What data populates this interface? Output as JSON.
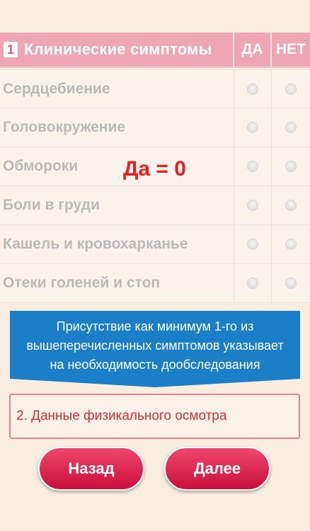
{
  "header": {
    "section_number": "1",
    "title": "Клинические симптомы",
    "col_yes": "ДА",
    "col_no": "НЕТ"
  },
  "symptoms": [
    {
      "label": "Сердцебиение"
    },
    {
      "label": "Головокружение"
    },
    {
      "label": "Обмороки"
    },
    {
      "label": "Боли в груди"
    },
    {
      "label": "Кашель и кровохарканье"
    },
    {
      "label": "Отеки голеней и стоп"
    }
  ],
  "result": "Да = 0",
  "info": {
    "line1": "Присутствие как минимум 1-го из",
    "line2": "вышеперечисленных симптомов указывает",
    "line3": "на необходимость дообследования"
  },
  "next_section": "2. Данные физикального осмотра",
  "buttons": {
    "back": "Назад",
    "next": "Далее"
  },
  "colors": {
    "header": "#eea6b5",
    "accent_red": "#e8201e",
    "info_blue": "#1a7fc6",
    "button": "#d81b47"
  }
}
